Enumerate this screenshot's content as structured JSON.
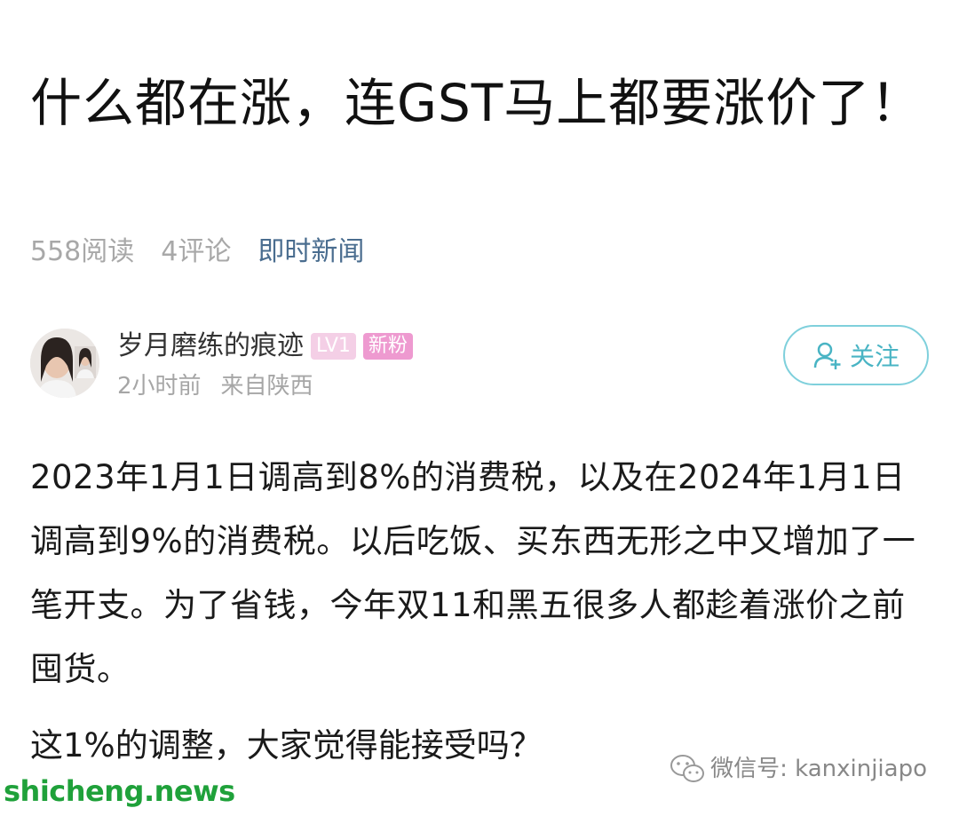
{
  "article": {
    "title": "什么都在涨，连GST马上都要涨价了！",
    "reads": "558阅读",
    "comments": "4评论",
    "category": "即时新闻"
  },
  "author": {
    "name": "岁月磨练的痕迹",
    "level_badge": "LV1",
    "fan_badge": "新粉",
    "time": "2小时前",
    "location": "来自陕西",
    "follow_label": "关注"
  },
  "content": {
    "paragraph": "2023年1月1日调高到8%的消费税，以及在2024年1月1日调高到9%的消费税。以后吃饭、买东西无形之中又增加了一笔开支。为了省钱，今年双11和黑五很多人都趁着涨价之前囤货。",
    "question": "这1%的调整，大家觉得能接受吗？"
  },
  "wechat": {
    "label": "微信号: kanxinjiapo",
    "icon": "wechat-icon"
  },
  "watermark": {
    "text": "shicheng.news"
  },
  "colors": {
    "category": "#4a6d8f",
    "follow": "#49b4c4",
    "fan_badge": "#ee9ad0",
    "watermark": "#1fa13a"
  }
}
